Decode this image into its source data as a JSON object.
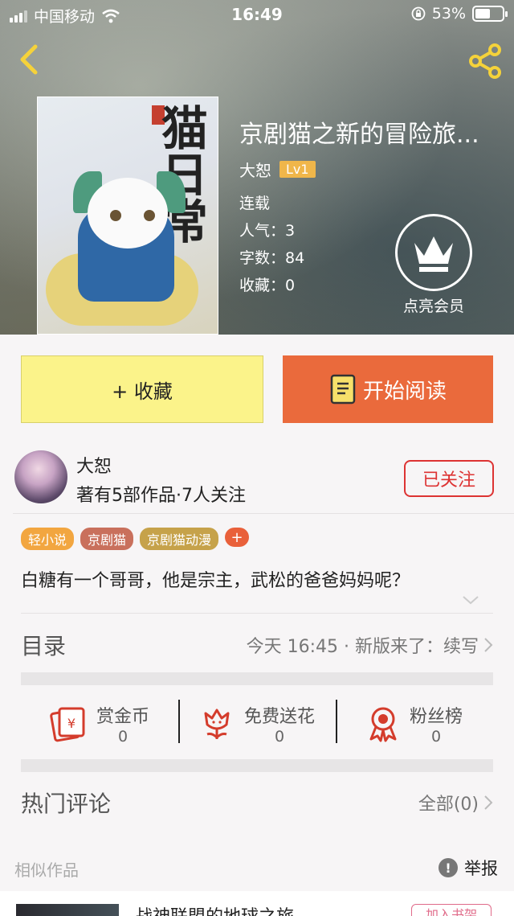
{
  "status": {
    "carrier": "中国移动",
    "time": "16:49",
    "battery": "53%"
  },
  "book": {
    "title": "京剧猫之新的冒险旅...",
    "cover_text": "猫日常",
    "author": "大恕",
    "level": "Lv1",
    "state": "连载",
    "popularity": "人气：3",
    "words": "字数：84",
    "favorites": "收藏：0"
  },
  "vip": {
    "label": "点亮会员"
  },
  "actions": {
    "favorite_label": "+ 收藏",
    "read_label": "开始阅读"
  },
  "author_card": {
    "name": "大恕",
    "stats": "著有5部作品·7人关注",
    "follow_label": "已关注"
  },
  "tags": [
    {
      "label": "轻小说",
      "color": "#f2a640"
    },
    {
      "label": "京剧猫",
      "color": "#c9705c"
    },
    {
      "label": "京剧猫动漫",
      "color": "#c6a24a"
    }
  ],
  "tag_more": "+",
  "summary": "白糖有一个哥哥，他是宗主，武松的爸爸妈妈呢？",
  "toc": {
    "label": "目录",
    "info": "今天 16:45 · 新版来了：续写"
  },
  "rewards": [
    {
      "label": "赏金币",
      "value": "0",
      "icon": "red-packet-icon"
    },
    {
      "label": "免费送花",
      "value": "0",
      "icon": "flower-icon"
    },
    {
      "label": "粉丝榜",
      "value": "0",
      "icon": "medal-icon"
    }
  ],
  "hot_comments": {
    "label": "热门评论",
    "all": "全部(0)"
  },
  "similar": {
    "label": "相似作品",
    "report": "举报",
    "item_title": "战神联盟的地球之旅",
    "item_action": "加入书架"
  },
  "colors": {
    "accent_orange": "#ea6a3c",
    "fav_yellow": "#fbf38a",
    "follow_red": "#dd3333"
  }
}
